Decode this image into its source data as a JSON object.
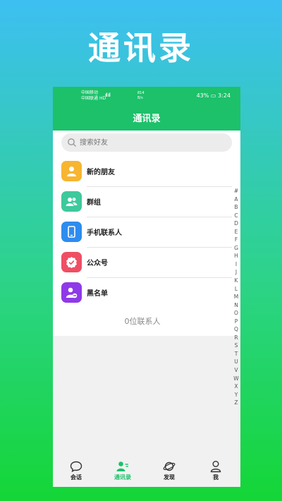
{
  "promo": {
    "title": "通讯录"
  },
  "statusbar": {
    "carrier1": "中国移动",
    "carrier2": "中国联通",
    "hd": "HD",
    "net_speed": "814",
    "net_unit": "B/s",
    "battery": "43%",
    "time": "3:24"
  },
  "header": {
    "title": "通讯录"
  },
  "search": {
    "placeholder": "搜索好友"
  },
  "items": [
    {
      "label": "新的朋友",
      "icon": "person-icon",
      "color": "#f7b530"
    },
    {
      "label": "群组",
      "icon": "group-icon",
      "color": "#3ec99c"
    },
    {
      "label": "手机联系人",
      "icon": "phone-icon",
      "color": "#2e8cf0"
    },
    {
      "label": "公众号",
      "icon": "verified-badge-icon",
      "color": "#ef4e64"
    },
    {
      "label": "黑名单",
      "icon": "blocked-user-icon",
      "color": "#8e3ae8"
    }
  ],
  "contacts_count": "0位联系人",
  "alphabet": [
    "#",
    "A",
    "B",
    "C",
    "D",
    "E",
    "F",
    "G",
    "H",
    "I",
    "J",
    "K",
    "L",
    "M",
    "N",
    "O",
    "P",
    "Q",
    "R",
    "S",
    "T",
    "U",
    "V",
    "W",
    "X",
    "Y",
    "Z"
  ],
  "tabs": [
    {
      "label": "会话",
      "icon": "chat-icon"
    },
    {
      "label": "通讯录",
      "icon": "contacts-icon",
      "active": true
    },
    {
      "label": "发现",
      "icon": "planet-icon"
    },
    {
      "label": "我",
      "icon": "profile-icon"
    }
  ],
  "colors": {
    "accent": "#1cc16a"
  }
}
